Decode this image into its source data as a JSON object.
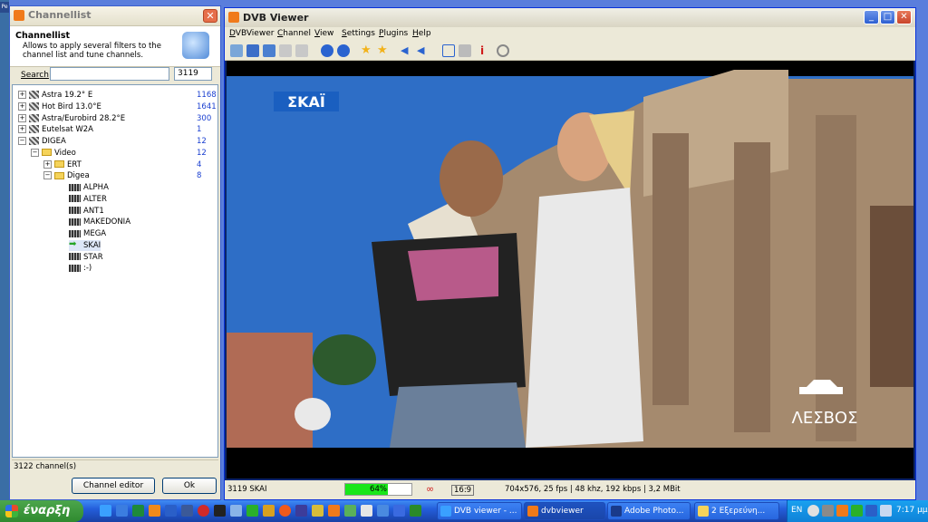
{
  "desktop": {
    "left_icon": "Pe"
  },
  "channellist": {
    "window_title": "Channellist",
    "header_title": "Channellist",
    "header_desc": "Allows to apply several filters to the channel list and tune channels.",
    "search_label": "Search",
    "search_value": "",
    "count_box": "3119",
    "tree": [
      {
        "label": "Astra 19.2° E",
        "count": "1168",
        "exp": "+",
        "icon": "satellite-icon"
      },
      {
        "label": "Hot Bird 13.0°E",
        "count": "1641",
        "exp": "+",
        "icon": "satellite-icon"
      },
      {
        "label": "Astra/Eurobird 28.2°E",
        "count": "300",
        "exp": "+",
        "icon": "satellite-icon"
      },
      {
        "label": "Eutelsat W2A",
        "count": "1",
        "exp": "+",
        "icon": "satellite-icon"
      },
      {
        "label": "DIGEA",
        "count": "12",
        "exp": "−",
        "icon": "satellite-icon"
      },
      {
        "label": "Video",
        "count": "12",
        "exp": "−",
        "icon": "folder-icon"
      },
      {
        "label": "ERT",
        "count": "4",
        "exp": "+",
        "icon": "folder-icon"
      },
      {
        "label": "Digea",
        "count": "8",
        "exp": "−",
        "icon": "folder-icon"
      },
      {
        "label": "ALPHA",
        "icon": "channel-icon"
      },
      {
        "label": "ALTER",
        "icon": "channel-icon"
      },
      {
        "label": "ANT1",
        "icon": "channel-icon"
      },
      {
        "label": "MAKEDONIA",
        "icon": "channel-icon"
      },
      {
        "label": "MEGA",
        "icon": "channel-icon"
      },
      {
        "label": "SKAI",
        "icon": "play-arrow-icon",
        "selected": true
      },
      {
        "label": "STAR",
        "icon": "channel-icon"
      },
      {
        "label": ":-)",
        "icon": "channel-icon"
      }
    ],
    "status": "3122 channel(s)",
    "channel_editor_label": "Channel editor",
    "ok_label": "Ok"
  },
  "dvb": {
    "window_title": "DVB Viewer",
    "menus": [
      "DVBViewer",
      "Channel",
      "View",
      "Settings",
      "Plugins",
      "Help"
    ],
    "video": {
      "logo": "ΣΚΑΪ",
      "location": "ΛΕΣΒΟΣ"
    },
    "status": {
      "channel": "3119 SKAI",
      "signal_text": "64%",
      "signal_level": 0.64,
      "aspect": "16:9",
      "info": "704x576, 25 fps | 48 khz, 192 kbps | 3,2 MBit"
    }
  },
  "taskbar": {
    "start_label": "έναρξη",
    "tasks": [
      {
        "label": "DVB viewer - ..."
      },
      {
        "label": "dvbviewer"
      },
      {
        "label": "Adobe Photo..."
      },
      {
        "label": "2 Εξερεύνη..."
      }
    ],
    "tray_lang": "EN",
    "clock": "7:17 μμ"
  },
  "colors": {
    "accent_blue": "#245edb",
    "signal_green": "#19e619",
    "count_blue": "#1a3fd0"
  }
}
